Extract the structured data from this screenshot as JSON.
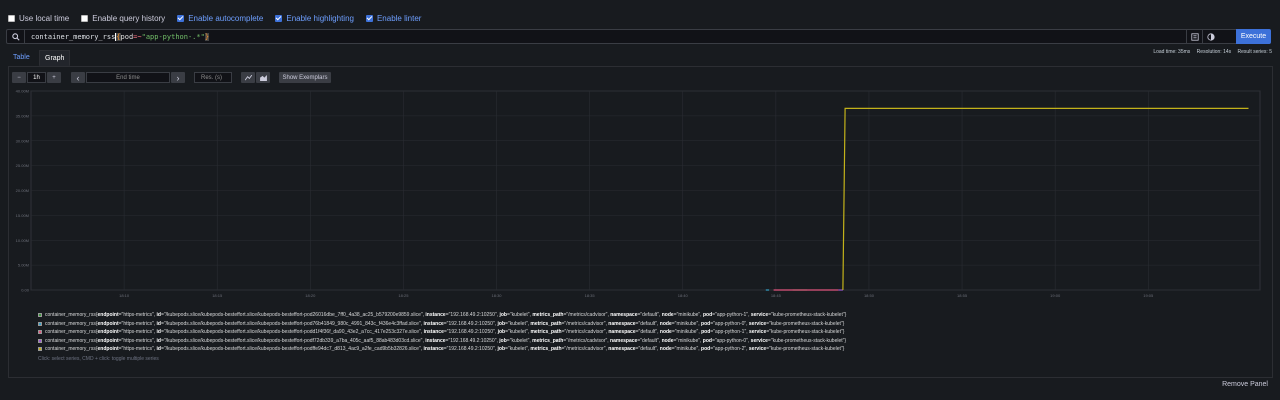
{
  "options": [
    {
      "label": "Use local time",
      "checked": false
    },
    {
      "label": "Enable query history",
      "checked": false
    },
    {
      "label": "Enable autocomplete",
      "checked": true
    },
    {
      "label": "Enable highlighting",
      "checked": true
    },
    {
      "label": "Enable linter",
      "checked": true
    }
  ],
  "query": {
    "metric": "container_memory_rss",
    "open_brace": "{",
    "label": "pod",
    "operator": "=~",
    "value": "\"app-python-.*\"",
    "close_brace": "}",
    "execute_label": "Execute",
    "search_icon": "search-icon",
    "format_icon": "format-icon",
    "metrics_explorer_icon": "globe-icon"
  },
  "stats": {
    "load_time": "Load time: 35ms",
    "resolution": "Resolution: 14s",
    "result_series": "Result series: 5"
  },
  "tabs": [
    {
      "label": "Table",
      "active": false
    },
    {
      "label": "Graph",
      "active": true
    }
  ],
  "controls": {
    "minus": "−",
    "range": "1h",
    "plus": "+",
    "prev": "‹",
    "end_time_placeholder": "End time",
    "next": "›",
    "res_placeholder": "Res. (s)",
    "line_icon": "line-chart-icon",
    "stacked_icon": "stacked-chart-icon",
    "exemplars": "Show Exemplars"
  },
  "chart_data": {
    "type": "line",
    "y_ticks": [
      "0.00",
      "5.00M",
      "10.00M",
      "15.00M",
      "20.00M",
      "25.00M",
      "30.00M",
      "35.00M",
      "40.00M"
    ],
    "ylim": [
      0,
      40000000
    ],
    "x_ticks": [
      "18:10",
      "18:15",
      "18:20",
      "18:25",
      "18:30",
      "18:35",
      "18:40",
      "18:45",
      "18:50",
      "18:55",
      "19:00",
      "19:05"
    ],
    "grid": true,
    "series": [
      {
        "color": "#3e9b3e",
        "points": [
          [
            18.765,
            0
          ],
          [
            18.778,
            0
          ]
        ]
      },
      {
        "color": "#37a2c8",
        "points": [
          [
            18.741,
            0
          ],
          [
            18.744,
            0
          ]
        ]
      },
      {
        "color": "#e0557d",
        "points": [
          [
            18.748,
            0
          ],
          [
            18.806,
            0
          ]
        ]
      },
      {
        "color": "#9b59d0",
        "points": [
          [
            18.806,
            0
          ],
          [
            18.81,
            0
          ]
        ]
      },
      {
        "color": "#c3b21a",
        "points": [
          [
            18.81,
            0
          ],
          [
            18.812,
            36500000
          ],
          [
            19.173,
            36500000
          ]
        ]
      }
    ]
  },
  "legend": [
    {
      "color": "#3e9b3e",
      "metric": "container_memory_rss",
      "endpoint": "https-metrics",
      "id": "/kubepods.slice/kubepods-besteffort.slice/kubepods-besteffort-pod26016dbe_7ff0_4a38_ac25_b579200e9859.slice",
      "instance": "192.168.49.2:10250",
      "job": "kubelet",
      "metrics_path": "/metrics/cadvisor",
      "namespace": "default",
      "node": "minikube",
      "pod": "app-python-1",
      "service": "kube-prometheus-stack-kubelet"
    },
    {
      "color": "#37a2c8",
      "metric": "container_memory_rss",
      "endpoint": "https-metrics",
      "id": "/kubepods.slice/kubepods-besteffort.slice/kubepods-besteffort-pod76b41849_980c_4991_843c_f436e4c3ffad.slice",
      "instance": "192.168.49.2:10250",
      "job": "kubelet",
      "metrics_path": "/metrics/cadvisor",
      "namespace": "default",
      "node": "minikube",
      "pod": "app-python-0",
      "service": "kube-prometheus-stack-kubelet"
    },
    {
      "color": "#e0557d",
      "metric": "container_memory_rss",
      "endpoint": "https-metrics",
      "id": "/kubepods.slice/kubepods-besteffort.slice/kubepods-besteffort-podd1f4f36f_da90_43e2_a7cc_417e253c327e.slice",
      "instance": "192.168.49.2:10250",
      "job": "kubelet",
      "metrics_path": "/metrics/cadvisor",
      "namespace": "default",
      "node": "minikube",
      "pod": "app-python-1",
      "service": "kube-prometheus-stack-kubelet"
    },
    {
      "color": "#9b59d0",
      "metric": "container_memory_rss",
      "endpoint": "https-metrics",
      "id": "/kubepods.slice/kubepods-besteffort.slice/kubepods-besteffort-podf72db339_a7ba_405c_aaf5_88ab483d03cd.slice",
      "instance": "192.168.49.2:10250",
      "job": "kubelet",
      "metrics_path": "/metrics/cadvisor",
      "namespace": "default",
      "node": "minikube",
      "pod": "app-python-0",
      "service": "kube-prometheus-stack-kubelet"
    },
    {
      "color": "#c3b21a",
      "metric": "container_memory_rss",
      "endpoint": "https-metrics",
      "id": "/kubepods.slice/kubepods-besteffort.slice/kubepods-besteffort-podffe94dc7_d813_4ac9_a2fe_cad9b5b32826.slice",
      "instance": "192.168.49.2:10250",
      "job": "kubelet",
      "metrics_path": "/metrics/cadvisor",
      "namespace": "default",
      "node": "minikube",
      "pod": "app-python-2",
      "service": "kube-prometheus-stack-kubelet"
    }
  ],
  "legend_hint": "Click: select series, CMD + click: toggle multiple series",
  "remove_panel": "Remove Panel",
  "colors": {
    "accent": "#3d71d9",
    "background": "#181b1f"
  }
}
